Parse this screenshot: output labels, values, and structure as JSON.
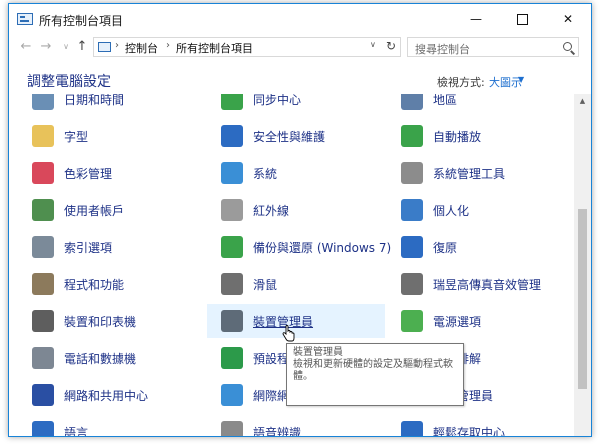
{
  "window": {
    "title": "所有控制台項目",
    "controls": {
      "minimize": "—",
      "maximize": "",
      "close": "✕"
    }
  },
  "nav": {
    "back": "←",
    "forward": "→",
    "history": "∨",
    "up": "↑",
    "breadcrumb": [
      "控制台",
      "所有控制台項目"
    ],
    "separator": "›",
    "dropdown": "∨",
    "refresh": "↻",
    "search_placeholder": "搜尋控制台"
  },
  "header": {
    "title": "調整電腦設定",
    "view_by_label": "檢視方式:",
    "view_by_value": "大圖示",
    "view_by_caret": "▼"
  },
  "items": [
    {
      "label": "日期和時間",
      "icon": "clock-icon",
      "color": "#6a8fb5"
    },
    {
      "label": "同步中心",
      "icon": "sync-icon",
      "color": "#3aa34a"
    },
    {
      "label": "地區",
      "icon": "region-clock-icon",
      "color": "#5f7fa8"
    },
    {
      "label": "字型",
      "icon": "font-icon",
      "color": "#e8c25a"
    },
    {
      "label": "安全性與維護",
      "icon": "flag-icon",
      "color": "#2c6bc2"
    },
    {
      "label": "自動播放",
      "icon": "autoplay-icon",
      "color": "#3aa34a"
    },
    {
      "label": "色彩管理",
      "icon": "color-management-icon",
      "color": "#d9485b"
    },
    {
      "label": "系統",
      "icon": "computer-icon",
      "color": "#3a8fd6"
    },
    {
      "label": "系統管理工具",
      "icon": "admin-tools-icon",
      "color": "#8c8c8c"
    },
    {
      "label": "使用者帳戶",
      "icon": "users-icon",
      "color": "#4f8f4f"
    },
    {
      "label": "紅外線",
      "icon": "infrared-icon",
      "color": "#9b9b9b"
    },
    {
      "label": "個人化",
      "icon": "personalization-icon",
      "color": "#3a7cc8"
    },
    {
      "label": "索引選項",
      "icon": "magnifier-icon",
      "color": "#7b8a99"
    },
    {
      "label": "備份與還原 (Windows 7)",
      "icon": "backup-icon",
      "color": "#3aa34a"
    },
    {
      "label": "復原",
      "icon": "recovery-icon",
      "color": "#2c6bc2"
    },
    {
      "label": "程式和功能",
      "icon": "programs-icon",
      "color": "#8c7a5c"
    },
    {
      "label": "滑鼠",
      "icon": "mouse-icon",
      "color": "#6f6f6f"
    },
    {
      "label": "瑞昱高傳真音效管理",
      "icon": "speaker-icon",
      "color": "#6f6f6f"
    },
    {
      "label": "裝置和印表機",
      "icon": "printer-icon",
      "color": "#5e5e5e"
    },
    {
      "label": "裝置管理員",
      "icon": "device-manager-icon",
      "color": "#5e6b78"
    },
    {
      "label": "電源選項",
      "icon": "battery-icon",
      "color": "#4caf50"
    },
    {
      "label": "電話和數據機",
      "icon": "phone-icon",
      "color": "#7d8793"
    },
    {
      "label": "預設程式",
      "icon": "default-programs-icon",
      "color": "#2c9a4a"
    },
    {
      "label": "疑難排解",
      "icon": "troubleshoot-icon",
      "color": "#2c6bc2"
    },
    {
      "label": "網路和共用中心",
      "icon": "network-icon",
      "color": "#2a4fa3"
    },
    {
      "label": "網際網路選項",
      "icon": "globe-icon",
      "color": "#3a8fd6"
    },
    {
      "label": "認證管理員",
      "icon": "credential-icon",
      "color": "#d99a2b"
    },
    {
      "label": "語言",
      "icon": "language-icon",
      "color": "#2c6bc2"
    },
    {
      "label": "語音辨識",
      "icon": "microphone-icon",
      "color": "#8a8a8a"
    },
    {
      "label": "輕鬆存取中心",
      "icon": "ease-of-access-icon",
      "color": "#2c6bc2"
    }
  ],
  "hovered_item": "裝置管理員",
  "tooltip": {
    "title": "裝置管理員",
    "line1": "檢視和更新硬體的設定及驅動程式軟",
    "line2": "體。"
  },
  "scrollbar": {
    "up_arrow": "▲"
  }
}
